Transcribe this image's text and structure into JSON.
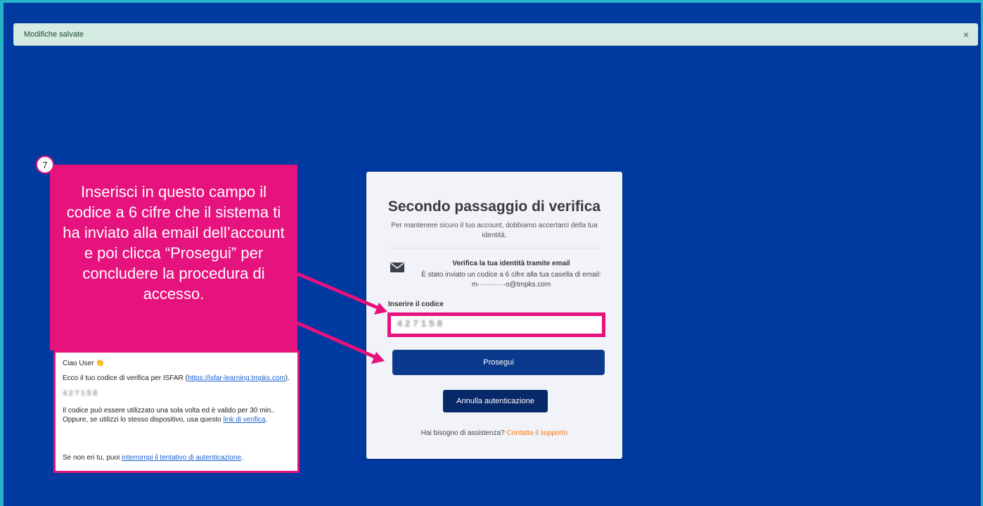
{
  "alert": {
    "message": "Modifiche salvate",
    "close_symbol": "×"
  },
  "card": {
    "title": "Secondo passaggio di verifica",
    "subtitle": "Per mantenere sicuro il tuo account, dobbiamo accertarci della tua identità.",
    "verify_title": "Verifica la tua identità tramite email",
    "verify_text": "È stato inviato un codice a 6 cifre alla tua casella di email: m············o@tmpks.com",
    "code_label": "Inserire il codice",
    "code_value": "427158",
    "submit_label": "Prosegui",
    "cancel_label": "Annulla autenticazione",
    "help_text": "Hai bisogno di assistenza?",
    "help_link": "Contatta il supporto"
  },
  "callout": {
    "step": "7",
    "text": "Inserisci in questo campo il codice a 6 cifre che il sistema ti ha inviato alla email dell’account e poi clicca “Prosegui” per concludere la procedura di accesso."
  },
  "email": {
    "greeting": "Ciao User 👏",
    "intro": "Ecco il tuo codice di verifica per ISFAR (",
    "intro_link": "https://isfar-learning.tmpks.com",
    "intro_end": ").",
    "code": "427158",
    "validity": "Il codice può essere utilizzato una sola volta ed è valido per 30 min..",
    "device_text": "Oppure, se utilizzi lo stesso dispositivo, usa questo ",
    "device_link": "link di verifica",
    "device_end": ".",
    "not_you": "Se non eri tu, puoi ",
    "not_you_link": "interrompi il tentativo di autenticazione",
    "not_you_end": "."
  },
  "colors": {
    "background": "#003aa0",
    "accent": "#e6127d",
    "primary": "#0b3a8c",
    "link": "#f07a1a"
  }
}
